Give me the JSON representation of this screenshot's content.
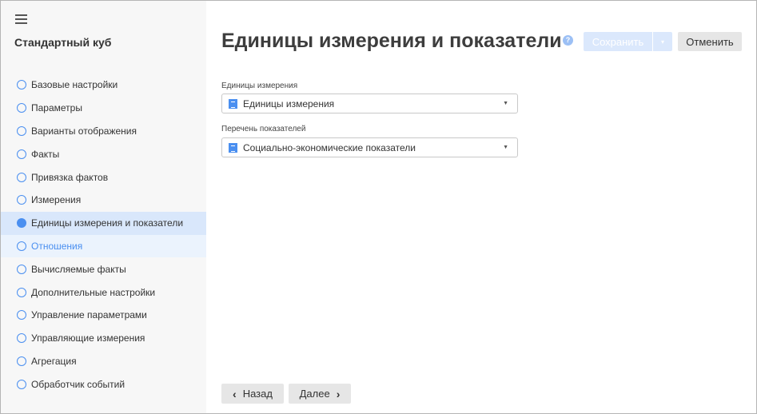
{
  "sidebar": {
    "title": "Стандартный куб",
    "items": [
      {
        "label": "Базовые настройки"
      },
      {
        "label": "Параметры"
      },
      {
        "label": "Варианты отображения"
      },
      {
        "label": "Факты"
      },
      {
        "label": "Привязка фактов"
      },
      {
        "label": "Измерения"
      },
      {
        "label": "Единицы измерения и показатели"
      },
      {
        "label": "Отношения"
      },
      {
        "label": "Вычисляемые факты"
      },
      {
        "label": "Дополнительные настройки"
      },
      {
        "label": "Управление параметрами"
      },
      {
        "label": "Управляющие измерения"
      },
      {
        "label": "Агрегация"
      },
      {
        "label": "Обработчик событий"
      }
    ]
  },
  "header": {
    "title": "Единицы измерения и показатели",
    "help": "?",
    "save": "Сохранить",
    "save_dropdown": "▾",
    "cancel": "Отменить"
  },
  "form": {
    "units_label": "Единицы измерения",
    "units_value": "Единицы измерения",
    "indicators_label": "Перечень показателей",
    "indicators_value": "Социально-экономические показатели",
    "arrow": "▼"
  },
  "footer": {
    "back": "Назад",
    "next": "Далее",
    "back_icon": "‹",
    "next_icon": "›"
  },
  "colors": {
    "accent": "#4a8ff0",
    "active_bg": "#d9e7fb",
    "hover_bg": "#ebf3fd"
  }
}
